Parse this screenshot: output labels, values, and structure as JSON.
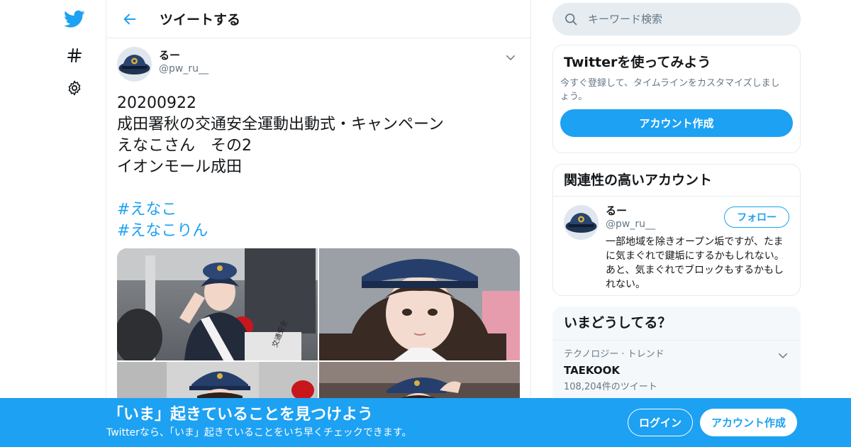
{
  "nav": {
    "icons": [
      "twitter-logo-icon",
      "hashtag-icon",
      "settings-icon"
    ],
    "brand_color": "#1da1f2"
  },
  "header": {
    "title": "ツイートする"
  },
  "tweet": {
    "author_name": "るー",
    "author_handle": "@pw_ru__",
    "text_lines": [
      "20200922",
      "成田署秋の交通安全運動出動式・キャンペーン",
      "えなこさん　その2",
      "イオンモール成田",
      ""
    ],
    "hashtags": [
      "#えなこ",
      "#えなこりん"
    ]
  },
  "search": {
    "placeholder": "キーワード検索"
  },
  "signup_card": {
    "title": "Twitterを使ってみよう",
    "description": "今すぐ登録して、タイムラインをカスタマイズしましょう。",
    "button_label": "アカウント作成"
  },
  "related": {
    "title": "関連性の高いアカウント",
    "name": "るー",
    "handle": "@pw_ru__",
    "follow_label": "フォロー",
    "bio": "一部地域を除きオープン垢ですが、たまに気まぐれで鍵垢にするかもしれない。 あと、気まぐれでブロックもするかもしれない。"
  },
  "trends": {
    "title": "いまどうしてる？",
    "items": [
      {
        "meta": "テクノロジー · トレンド",
        "name": "TAEKOOK",
        "count": "108,204件のツイート"
      }
    ]
  },
  "banner": {
    "title": "「いま」起きていることを見つけよう",
    "subtitle": "Twitterなら、「いま」起きていることをいち早くチェックできます。",
    "login_label": "ログイン",
    "signup_label": "アカウント作成"
  }
}
